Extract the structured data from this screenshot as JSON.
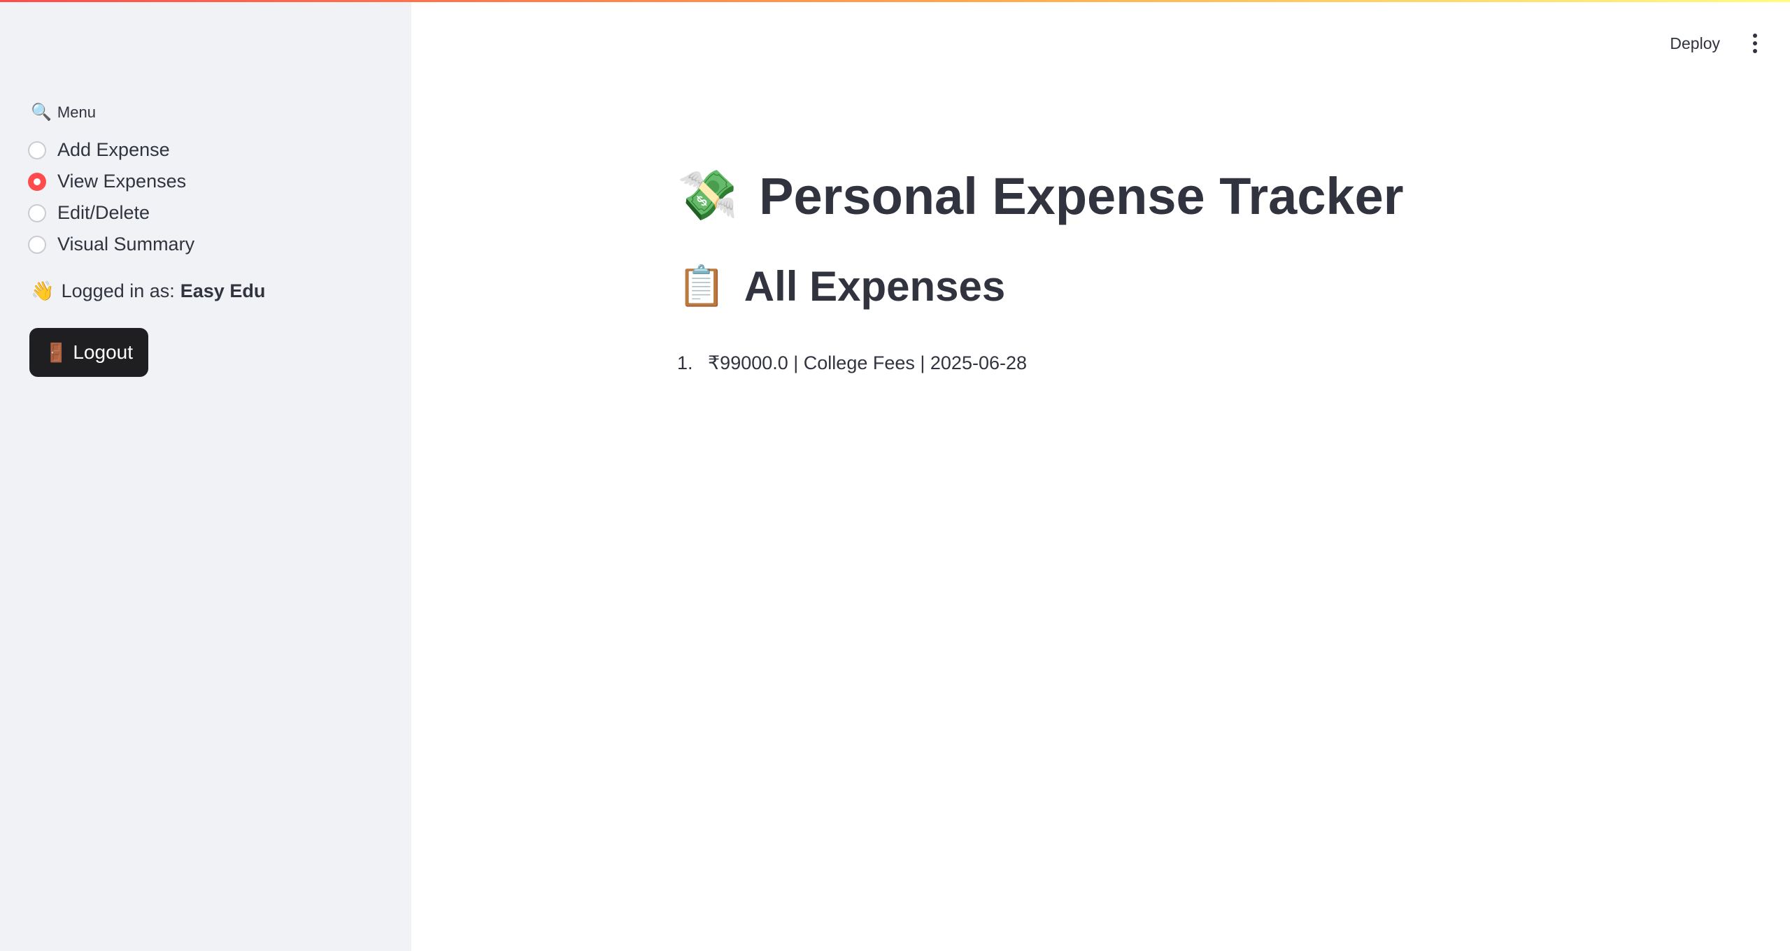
{
  "sidebar": {
    "menu_label": "Menu",
    "menu_icon": "🔍",
    "options": [
      {
        "label": "Add Expense",
        "selected": false
      },
      {
        "label": "View Expenses",
        "selected": true
      },
      {
        "label": "Edit/Delete",
        "selected": false
      },
      {
        "label": "Visual Summary",
        "selected": false
      }
    ],
    "logged_in_prefix": "Logged in as:",
    "logged_in_user": "Easy Edu",
    "logged_in_icon": "👋",
    "logout_icon": "🚪",
    "logout_label": "Logout"
  },
  "header": {
    "deploy_label": "Deploy",
    "menu_icon": "kebab-menu-icon"
  },
  "main": {
    "title_icon": "💸",
    "title": "Personal Expense Tracker",
    "section_icon": "📋",
    "section_title": "All Expenses",
    "expenses": [
      {
        "number": "1.",
        "text": "₹99000.0 | College Fees | 2025-06-28"
      }
    ]
  },
  "colors": {
    "accent": "#ff4b4b",
    "sidebar_bg": "#f0f2f6",
    "text": "#31333f",
    "button_bg": "#1f1f21"
  }
}
